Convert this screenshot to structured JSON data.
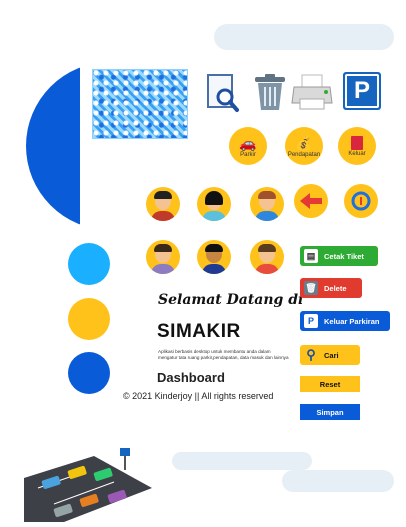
{
  "top_icons": {
    "search": "document-search-icon",
    "trash": "trash-icon",
    "printer": "printer-icon",
    "parking": {
      "icon": "parking-sign-icon",
      "letter": "P"
    }
  },
  "menu": {
    "parkir": "Parkir",
    "pendapatan": "Pendapatan",
    "keluar": "Keluar"
  },
  "welcome": {
    "greeting": "Selamat Datang di",
    "app_name": "SIMAKIR",
    "description": "Aplikasi berbasis desktop untuk membantu anda dalam mengatur tata ruang parkir,pendapatan, data masuk dan lainnya",
    "section": "Dashboard",
    "copyright": "© 2021 Kinderjoy || All rights reserved"
  },
  "actions": {
    "cetak_tiket": "Cetak Tiket",
    "delete": "Delete",
    "keluar_parkiran": "Keluar Parkiran",
    "cari": "Cari",
    "reset": "Reset",
    "simpan": "Simpan"
  },
  "colors": {
    "primary_blue": "#0a5bd8",
    "yellow": "#ffc21a",
    "light_blue": "#1ab0ff",
    "green": "#2eab34",
    "red": "#e03b2e"
  }
}
